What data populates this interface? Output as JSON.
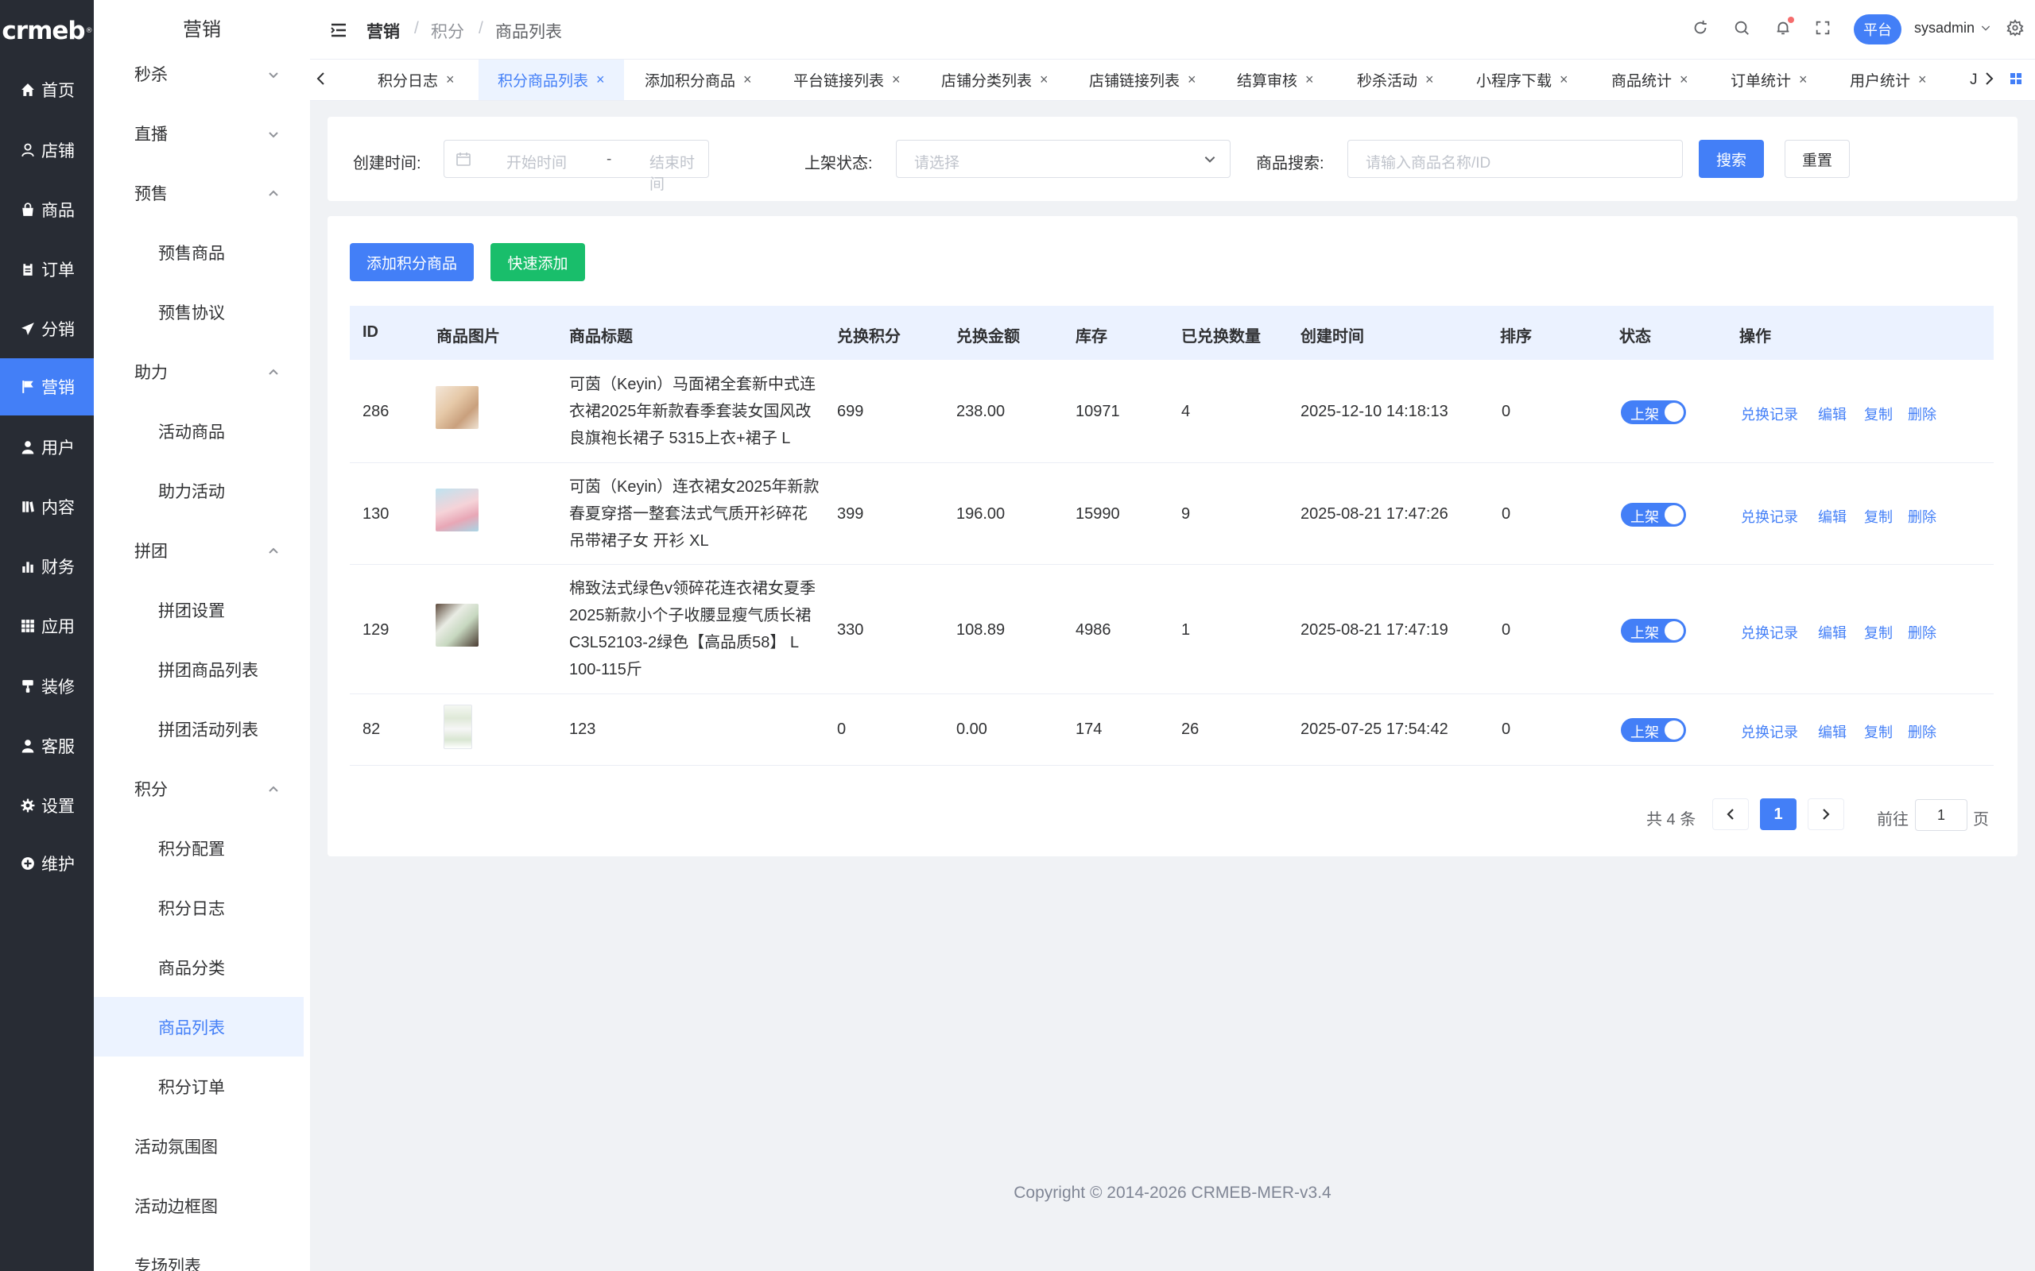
{
  "brand": {
    "logo_text": "crmeb",
    "logo_mark": "®"
  },
  "main_nav": [
    {
      "label": "首页",
      "icon": "home-icon"
    },
    {
      "label": "店铺",
      "icon": "store-icon"
    },
    {
      "label": "商品",
      "icon": "bag-icon"
    },
    {
      "label": "订单",
      "icon": "clipboard-icon"
    },
    {
      "label": "分销",
      "icon": "send-icon"
    },
    {
      "label": "营销",
      "icon": "flag-icon",
      "active": true
    },
    {
      "label": "用户",
      "icon": "user-icon"
    },
    {
      "label": "内容",
      "icon": "book-icon"
    },
    {
      "label": "财务",
      "icon": "bar-chart-icon"
    },
    {
      "label": "应用",
      "icon": "grid-icon"
    },
    {
      "label": "装修",
      "icon": "paint-icon"
    },
    {
      "label": "客服",
      "icon": "headset-icon"
    },
    {
      "label": "设置",
      "icon": "gear-icon"
    },
    {
      "label": "维护",
      "icon": "plus-circle-icon"
    }
  ],
  "submenu": {
    "title": "营销",
    "items": [
      {
        "label": "秒杀",
        "type": "group",
        "arrow": "down"
      },
      {
        "label": "直播",
        "type": "group",
        "arrow": "down"
      },
      {
        "label": "预售",
        "type": "group",
        "arrow": "up"
      },
      {
        "label": "预售商品",
        "type": "child"
      },
      {
        "label": "预售协议",
        "type": "child"
      },
      {
        "label": "助力",
        "type": "group",
        "arrow": "up"
      },
      {
        "label": "活动商品",
        "type": "child"
      },
      {
        "label": "助力活动",
        "type": "child"
      },
      {
        "label": "拼团",
        "type": "group",
        "arrow": "up"
      },
      {
        "label": "拼团设置",
        "type": "child"
      },
      {
        "label": "拼团商品列表",
        "type": "child"
      },
      {
        "label": "拼团活动列表",
        "type": "child"
      },
      {
        "label": "积分",
        "type": "group",
        "arrow": "up"
      },
      {
        "label": "积分配置",
        "type": "child"
      },
      {
        "label": "积分日志",
        "type": "child"
      },
      {
        "label": "商品分类",
        "type": "child"
      },
      {
        "label": "商品列表",
        "type": "child",
        "active": true
      },
      {
        "label": "积分订单",
        "type": "child"
      },
      {
        "label": "活动氛围图",
        "type": "group"
      },
      {
        "label": "活动边框图",
        "type": "group"
      },
      {
        "label": "专场列表",
        "type": "group"
      }
    ]
  },
  "header": {
    "breadcrumb": [
      "营销",
      "积分",
      "商品列表"
    ],
    "platform_label": "平台",
    "username": "sysadmin"
  },
  "tags": [
    {
      "label": "积分日志"
    },
    {
      "label": "积分商品列表",
      "active": true
    },
    {
      "label": "添加积分商品"
    },
    {
      "label": "平台链接列表"
    },
    {
      "label": "店铺分类列表"
    },
    {
      "label": "店铺链接列表"
    },
    {
      "label": "结算审核"
    },
    {
      "label": "秒杀活动"
    },
    {
      "label": "小程序下载"
    },
    {
      "label": "商品统计"
    },
    {
      "label": "订单统计"
    },
    {
      "label": "用户统计"
    },
    {
      "label": "J"
    }
  ],
  "filters": {
    "created_label": "创建时间:",
    "start_placeholder": "开始时间",
    "range_sep": "-",
    "end_placeholder": "结束时间",
    "status_label": "上架状态:",
    "status_placeholder": "请选择",
    "search_label": "商品搜索:",
    "search_placeholder": "请输入商品名称/ID",
    "search_button": "搜索",
    "reset_button": "重置"
  },
  "actions": {
    "add_button": "添加积分商品",
    "quick_add_button": "快速添加"
  },
  "table": {
    "columns": [
      "ID",
      "商品图片",
      "商品标题",
      "兑换积分",
      "兑换金额",
      "库存",
      "已兑换数量",
      "创建时间",
      "排序",
      "状态",
      "操作"
    ],
    "rows": [
      {
        "id": "286",
        "title": "可茵（Keyin）马面裙全套新中式连衣裙2025年新款春季套装女国风改良旗袍长裙子 5315上衣+裙子 L",
        "points": "699",
        "amount": "238.00",
        "stock": "10971",
        "redeemed": "4",
        "created": "2025-12-10 14:18:13",
        "sort": "0",
        "status": "上架"
      },
      {
        "id": "130",
        "title": "可茵（Keyin）连衣裙女2025年新款春夏穿搭一整套法式气质开衫碎花吊带裙子女 开衫 XL",
        "points": "399",
        "amount": "196.00",
        "stock": "15990",
        "redeemed": "9",
        "created": "2025-08-21 17:47:26",
        "sort": "0",
        "status": "上架"
      },
      {
        "id": "129",
        "title": "棉致法式绿色v领碎花连衣裙女夏季2025新款小个子收腰显瘦气质长裙C3L52103-2绿色【高品质58】 L 100-115斤",
        "points": "330",
        "amount": "108.89",
        "stock": "4986",
        "redeemed": "1",
        "created": "2025-08-21 17:47:19",
        "sort": "0",
        "status": "上架"
      },
      {
        "id": "82",
        "title": "123",
        "points": "0",
        "amount": "0.00",
        "stock": "174",
        "redeemed": "26",
        "created": "2025-07-25 17:54:42",
        "sort": "0",
        "status": "上架"
      }
    ],
    "row_actions": [
      "兑换记录",
      "编辑",
      "复制",
      "删除"
    ]
  },
  "pagination": {
    "total_text": "共 4 条",
    "current_page": "1",
    "goto_label": "前往",
    "goto_value": "1",
    "page_suffix": "页"
  },
  "footer": "Copyright © 2014-2026 CRMEB-MER-v3.4",
  "colors": {
    "primary": "#437ff7",
    "success": "#19be6b",
    "rail": "#282c34"
  }
}
